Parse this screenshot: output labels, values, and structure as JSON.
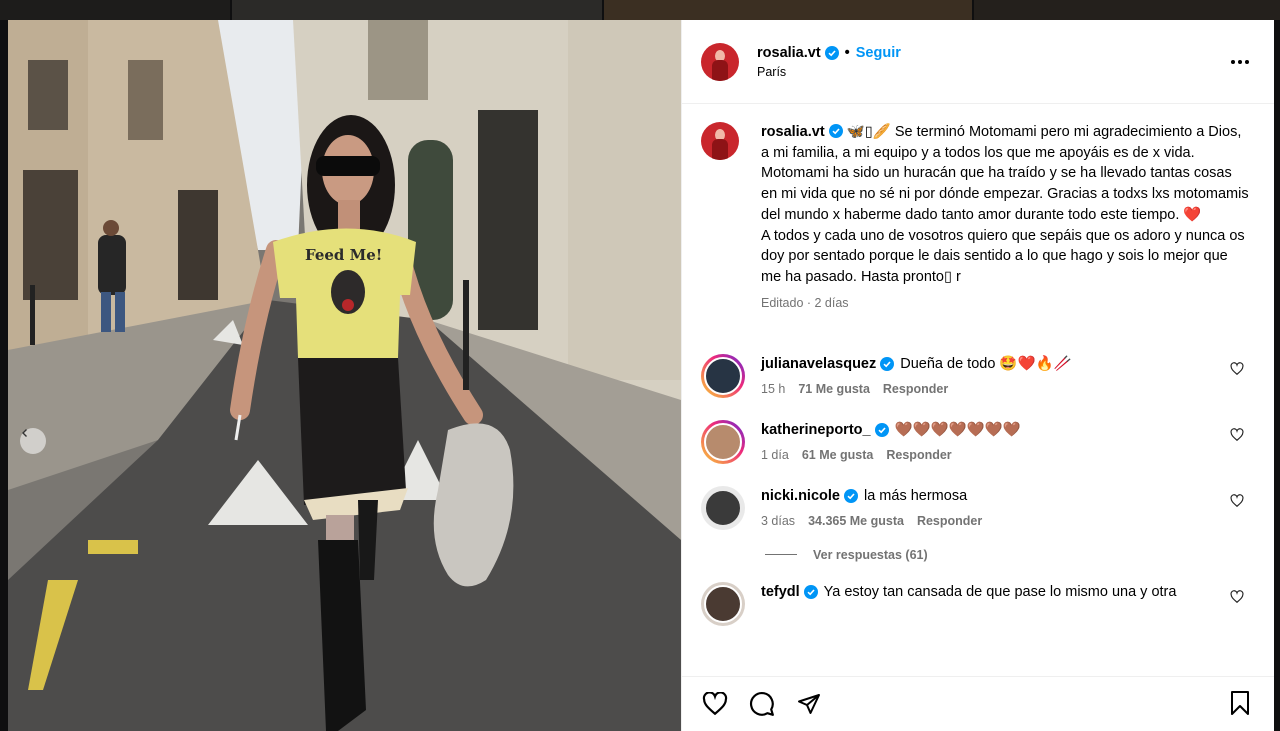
{
  "post": {
    "username": "rosalia.vt",
    "follow_label": "Seguir",
    "location": "París",
    "caption_user": "rosalia.vt",
    "caption": "🦋▯🥖 Se terminó Motomami pero mi agradecimiento a Dios, a mi familia, a mi equipo y a todos los que me apoyáis es de x vida. Motomami ha sido un huracán que ha traído y se ha llevado tantas cosas en mi vida que no sé ni por dónde empezar. Gracias a todxs lxs motomamis del mundo x haberme dado tanto amor durante todo este tiempo. ❤️\nA todos y cada uno de vosotros quiero que sepáis que os adoro y nunca os doy por sentado porque le dais sentido a lo que hago y sois lo mejor que me ha pasado. Hasta pronto▯ r",
    "meta": "Editado · 2 días",
    "photo_text": "Feed Me!"
  },
  "comments": [
    {
      "user": "julianavelasquez",
      "text": "Dueña de todo 🤩❤️🔥🥢",
      "time": "15 h",
      "likes": "71 Me gusta",
      "reply": "Responder"
    },
    {
      "user": "katherineporto_",
      "text": "🤎🤎🤎🤎🤎🤎🤎",
      "time": "1 día",
      "likes": "61 Me gusta",
      "reply": "Responder"
    },
    {
      "user": "nicki.nicole",
      "text": "la más hermosa",
      "time": "3 días",
      "likes": "34.365 Me gusta",
      "reply": "Responder"
    },
    {
      "user": "tefydl",
      "text": "Ya estoy tan cansada de que pase lo mismo una y otra"
    }
  ],
  "replies_label": "Ver respuestas (61)",
  "colors": {
    "accent": "#0095f6",
    "verified": "#0095f6",
    "muted": "#737373",
    "divider": "#efefef"
  },
  "icons": [
    "verified-icon",
    "more-icon",
    "heart-icon",
    "comment-icon",
    "share-icon",
    "save-icon",
    "chevron-left-icon"
  ]
}
